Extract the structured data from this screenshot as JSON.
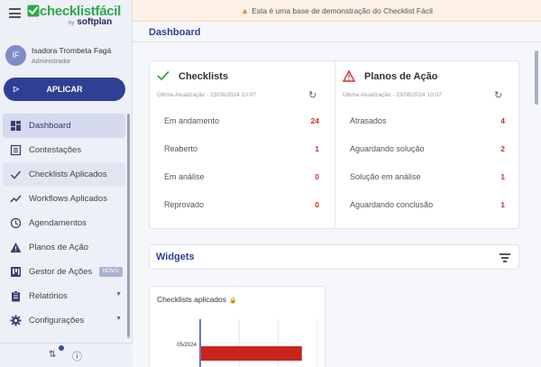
{
  "app": {
    "brand": "checklistfácil",
    "brand_by": "by",
    "brand_sub": "softplan"
  },
  "user": {
    "initials": "IF",
    "name": "Isadora Trombeta Fagá",
    "role": "Administrador"
  },
  "sidebar": {
    "apply_label": "APLICAR",
    "items": [
      {
        "label": "Dashboard",
        "icon": "dashboard-icon"
      },
      {
        "label": "Contestações",
        "icon": "list-icon"
      },
      {
        "label": "Checklists Aplicados",
        "icon": "check-icon"
      },
      {
        "label": "Workflows Aplicados",
        "icon": "trend-icon"
      },
      {
        "label": "Agendamentos",
        "icon": "clock-icon"
      },
      {
        "label": "Planos de Ação",
        "icon": "warning-icon"
      },
      {
        "label": "Gestor de Ações",
        "icon": "board-icon",
        "badge": "NOVO"
      },
      {
        "label": "Relatórios",
        "icon": "clipboard-icon"
      },
      {
        "label": "Configurações",
        "icon": "gear-icon"
      }
    ]
  },
  "banner": {
    "text": "Esta é uma base de demonstração do Checklist Fácil"
  },
  "page": {
    "title": "Dashboard"
  },
  "checklists": {
    "title": "Checklists",
    "updated": "Última Atualização - 23/08/2024 10:07",
    "rows": [
      {
        "label": "Em andamento",
        "value": "24"
      },
      {
        "label": "Reaberto",
        "value": "1"
      },
      {
        "label": "Em análise",
        "value": "0"
      },
      {
        "label": "Reprovado",
        "value": "0"
      }
    ]
  },
  "action_plans": {
    "title": "Planos de Ação",
    "updated": "Última Atualização - 23/08/2024 10:07",
    "rows": [
      {
        "label": "Atrasados",
        "value": "4"
      },
      {
        "label": "Aguardando solução",
        "value": "2"
      },
      {
        "label": "Solução em análise",
        "value": "1"
      },
      {
        "label": "Aguardando conclusão",
        "value": "1"
      }
    ]
  },
  "widgets": {
    "title": "Widgets"
  },
  "chart_data": {
    "type": "bar",
    "title": "Checklists aplicados",
    "categories": [
      "05/2024"
    ],
    "series": [
      {
        "values": [
          1
        ]
      }
    ],
    "orientation": "horizontal",
    "bar_color": "#c8261c"
  },
  "colors": {
    "accent": "#2f3f94",
    "success": "#2fa84a",
    "danger": "#d32f2f",
    "warning": "#e08a2c"
  }
}
